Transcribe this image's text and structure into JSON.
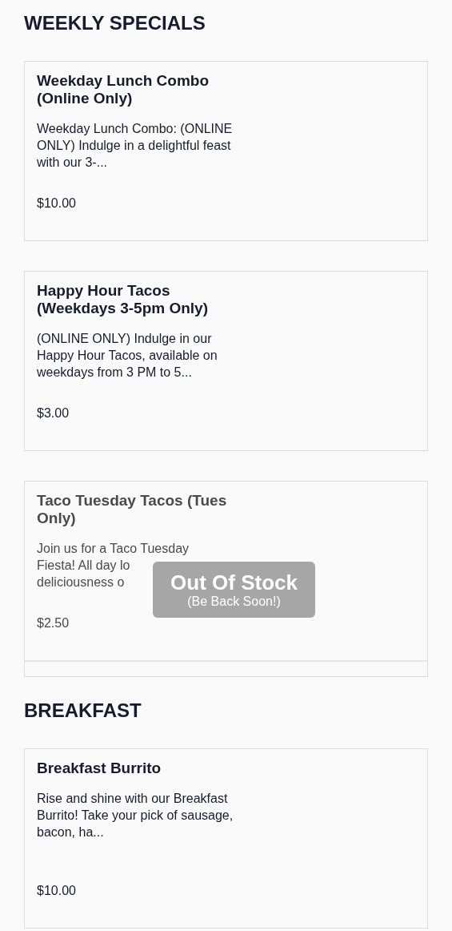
{
  "sections": [
    {
      "title": "WEEKLY SPECIALS",
      "items": [
        {
          "name": "Weekday Lunch Combo (Online Only)",
          "description": "Weekday Lunch Combo: (ONLINE ONLY) Indulge in a delightful feast with our 3-...",
          "price": "$10.00",
          "out_of_stock": false
        },
        {
          "name": "Happy Hour Tacos (Weekdays 3-5pm Only)",
          "description": "(ONLINE ONLY) Indulge in our Happy Hour Tacos, available on weekdays from 3 PM to 5...",
          "price": "$3.00",
          "out_of_stock": false
        },
        {
          "name": "Taco Tuesday Tacos (Tues Only)",
          "description_lines": [
            "Join us for a Taco Tuesday",
            "Fiesta! All day lo",
            "deliciousness o"
          ],
          "price": "$2.50",
          "out_of_stock": true,
          "badge_title": "Out Of Stock",
          "badge_subtitle": "(Be Back Soon!)"
        }
      ]
    },
    {
      "title": "BREAKFAST",
      "items": [
        {
          "name": "Breakfast Burrito",
          "description": "Rise and shine with our Breakfast Burrito! Take your pick of sausage, bacon, ha...",
          "price": "$10.00",
          "out_of_stock": false
        }
      ]
    }
  ]
}
